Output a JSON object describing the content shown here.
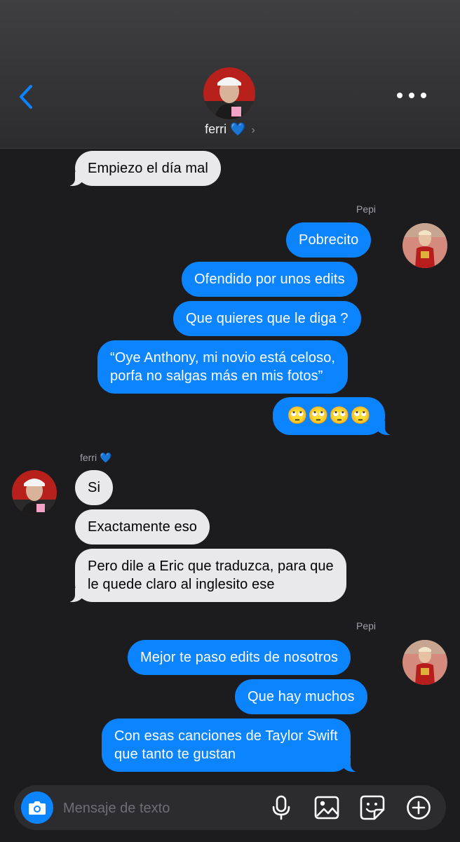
{
  "header": {
    "contact_name": "ferri 💙",
    "chevron": "›"
  },
  "messages": [
    {
      "text": "Empiezo el día mal",
      "direction": "incoming"
    },
    {
      "sender": "Pepi"
    },
    {
      "text": "Pobrecito",
      "direction": "outgoing"
    },
    {
      "text": "Ofendido por unos edits",
      "direction": "outgoing"
    },
    {
      "text": "Que quieres que le diga ?",
      "direction": "outgoing"
    },
    {
      "line1": "“Oye Anthony, mi novio está celoso,",
      "line2": "porfa no salgas más en mis fotos”",
      "direction": "outgoing"
    },
    {
      "text": "🙄🙄🙄🙄",
      "direction": "outgoing"
    },
    {
      "sender": "ferri 💙"
    },
    {
      "text": "Si",
      "direction": "incoming"
    },
    {
      "text": "Exactamente eso",
      "direction": "incoming"
    },
    {
      "line1": "Pero dile a Eric que traduzca, para que",
      "line2": "le quede claro al inglesito ese",
      "direction": "incoming"
    },
    {
      "sender": "Pepi"
    },
    {
      "text": "Mejor te paso edits de nosotros",
      "direction": "outgoing"
    },
    {
      "text": "Que hay muchos",
      "direction": "outgoing"
    },
    {
      "line1": "Con esas canciones de Taylor Swift",
      "line2": "que tanto te gustan",
      "direction": "outgoing"
    }
  ],
  "composer": {
    "placeholder": "Mensaje de texto",
    "icons": [
      "camera-icon",
      "microphone-icon",
      "gallery-icon",
      "sticker-icon",
      "plus-icon"
    ]
  },
  "colors": {
    "background": "#1c1c1e",
    "outgoing_bubble": "#0b84fe",
    "incoming_bubble": "#e9e9eb",
    "accent": "#0b84fe"
  }
}
